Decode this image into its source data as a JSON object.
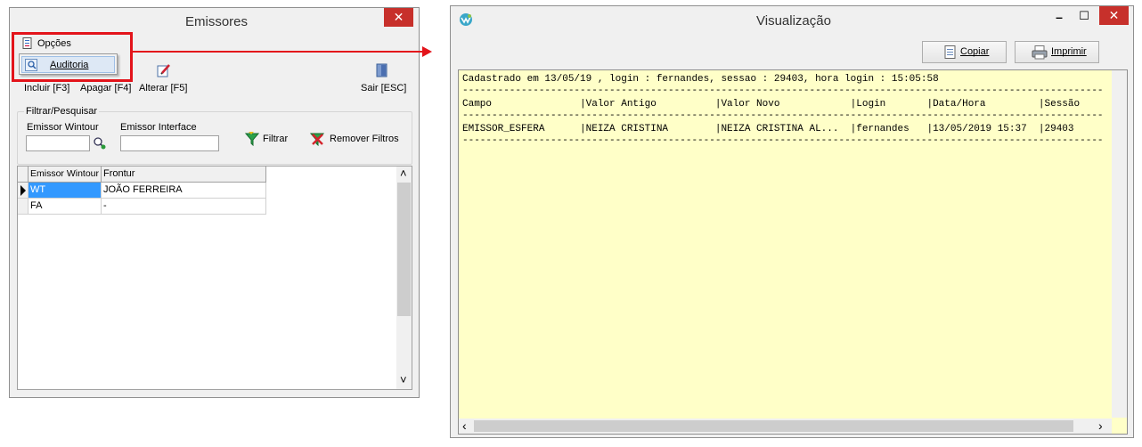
{
  "emissores": {
    "title": "Emissores",
    "close_glyph": "✕",
    "menu": {
      "opcoes_label": "Opções",
      "auditoria_label": "Auditoria"
    },
    "toolbar": {
      "incluir_label": "Incluir [F3]",
      "apagar_label": "Apagar [F4]",
      "alterar_label": "Alterar [F5]",
      "sair_label": "Sair [ESC]"
    },
    "filter": {
      "group_label": "Filtrar/Pesquisar",
      "wintour_label": "Emissor Wintour",
      "interface_label": "Emissor Interface",
      "wintour_value": "",
      "interface_value": "",
      "filtrar_label": "Filtrar",
      "remover_label": "Remover Filtros"
    },
    "grid": {
      "headers": [
        "Emissor Wintour",
        "Frontur"
      ],
      "rows": [
        [
          "WT",
          "JOÃO FERREIRA"
        ],
        [
          "FA",
          "-"
        ]
      ],
      "scroll_up": "˄",
      "scroll_down": "˅"
    }
  },
  "visualizacao": {
    "title": "Visualização",
    "controls": {
      "minimize": "–",
      "maximize": "☐",
      "close": "✕"
    },
    "buttons": {
      "copiar_label": "Copiar",
      "imprimir_label": "Imprimir"
    },
    "report": {
      "line1": "Cadastrado em 13/05/19 , login : fernandes, sessao : 29403, hora login : 15:05:58",
      "separator": "-------------------------------------------------------------------------------------------------------------",
      "header": "Campo               |Valor Antigo          |Valor Novo            |Login       |Data/Hora         |Sessão",
      "row": "EMISSOR_ESFERA      |NEIZA CRISTINA        |NEIZA CRISTINA AL...  |fernandes   |13/05/2019 15:37  |29403"
    },
    "scroll_left": "‹",
    "scroll_right": "›"
  },
  "colors": {
    "highlight_red": "#e3141b",
    "report_bg": "#ffffc8",
    "selection_blue": "#3399ff"
  }
}
